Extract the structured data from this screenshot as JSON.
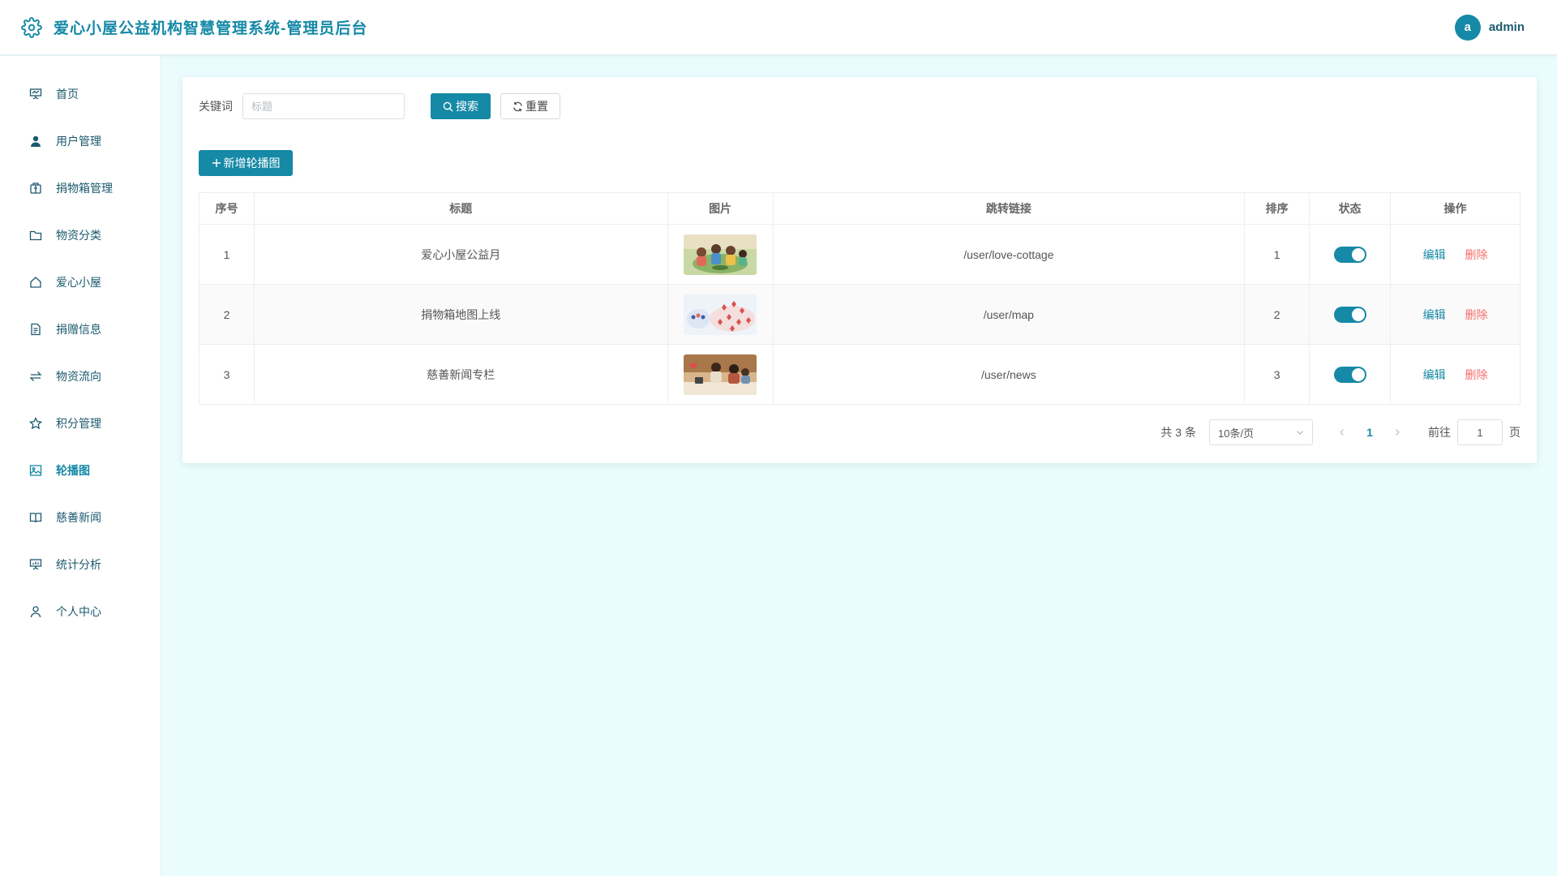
{
  "header": {
    "title": "爱心小屋公益机构智慧管理系统-管理员后台",
    "avatar_letter": "a",
    "username": "admin"
  },
  "sidebar": {
    "items": [
      {
        "label": "首页",
        "icon": "presentation-icon"
      },
      {
        "label": "用户管理",
        "icon": "user-icon"
      },
      {
        "label": "捐物箱管理",
        "icon": "box-icon"
      },
      {
        "label": "物资分类",
        "icon": "folder-icon"
      },
      {
        "label": "爱心小屋",
        "icon": "house-icon"
      },
      {
        "label": "捐赠信息",
        "icon": "document-icon"
      },
      {
        "label": "物资流向",
        "icon": "switch-arrows-icon"
      },
      {
        "label": "积分管理",
        "icon": "star-icon"
      },
      {
        "label": "轮播图",
        "icon": "picture-icon"
      },
      {
        "label": "慈善新闻",
        "icon": "book-icon"
      },
      {
        "label": "统计分析",
        "icon": "chart-board-icon"
      },
      {
        "label": "个人中心",
        "icon": "person-icon"
      }
    ],
    "active_index": 8
  },
  "search": {
    "label": "关键词",
    "placeholder": "标题",
    "value": "",
    "search_label": "搜索",
    "reset_label": "重置"
  },
  "toolbar": {
    "add_label": "新增轮播图"
  },
  "table": {
    "columns": [
      "序号",
      "标题",
      "图片",
      "跳转链接",
      "排序",
      "状态",
      "操作"
    ],
    "rows": [
      {
        "index": "1",
        "title": "爱心小屋公益月",
        "image": "volunteers-photo",
        "link": "/user/love-cottage",
        "sort": "1",
        "enabled": true
      },
      {
        "index": "2",
        "title": "捐物箱地图上线",
        "image": "map-illustration",
        "link": "/user/map",
        "sort": "2",
        "enabled": true
      },
      {
        "index": "3",
        "title": "慈善新闻专栏",
        "image": "news-photo",
        "link": "/user/news",
        "sort": "3",
        "enabled": true
      }
    ],
    "edit_label": "编辑",
    "delete_label": "删除"
  },
  "pagination": {
    "total_text": "共 3 条",
    "page_size": "10条/页",
    "current_page": "1",
    "goto_label": "前往",
    "goto_value": "1",
    "page_suffix": "页"
  },
  "colors": {
    "accent": "#1589a6",
    "danger": "#f56c6c",
    "background": "#eafcfd"
  }
}
